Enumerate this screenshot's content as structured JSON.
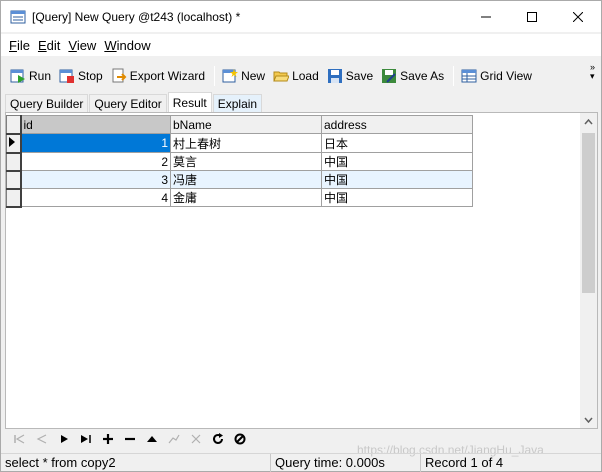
{
  "window": {
    "title": "[Query] New Query @t243 (localhost) *"
  },
  "menu": [
    {
      "label": "File",
      "key": "F",
      "rest": "ile"
    },
    {
      "label": "Edit",
      "key": "E",
      "rest": "dit"
    },
    {
      "label": "View",
      "key": "V",
      "rest": "iew"
    },
    {
      "label": "Window",
      "key": "W",
      "rest": "indow"
    }
  ],
  "toolbar": {
    "run": "Run",
    "stop": "Stop",
    "export": "Export Wizard",
    "new": "New",
    "load": "Load",
    "save": "Save",
    "save_as": "Save As",
    "grid_view": "Grid View"
  },
  "tabs": {
    "query_builder": "Query Builder",
    "query_editor": "Query Editor",
    "result": "Result",
    "explain": "Explain"
  },
  "grid": {
    "columns": [
      "id",
      "bName",
      "address"
    ],
    "rows": [
      {
        "id": "1",
        "bName": "村上春树",
        "address": "日本"
      },
      {
        "id": "2",
        "bName": "莫言",
        "address": "中国"
      },
      {
        "id": "3",
        "bName": "冯唐",
        "address": "中国"
      },
      {
        "id": "4",
        "bName": "金庸",
        "address": "中国"
      }
    ]
  },
  "status": {
    "sql": "select * from copy2",
    "query_time": "Query time: 0.000s",
    "record": "Record 1 of 4"
  },
  "watermark": "https://blog.csdn.net/JiangHu_Java",
  "colors": {
    "selection": "#0078d7",
    "alt_row": "#e8f4ff"
  }
}
